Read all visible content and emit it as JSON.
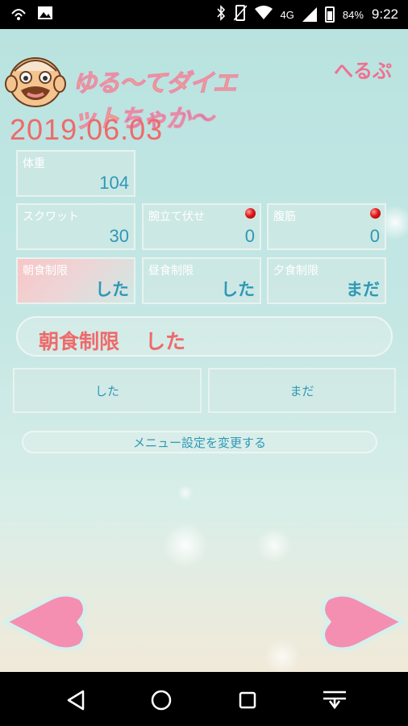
{
  "status_bar": {
    "battery_percent": "84%",
    "time": "9:22",
    "network": "4G"
  },
  "header": {
    "logo_text_main": "ゆる～てダイエット",
    "logo_text_accent": "ちゃか～",
    "help_label": "へるぷ"
  },
  "date": "2019.06.03",
  "stats": {
    "weight": {
      "label": "体重",
      "value": "104"
    },
    "squat": {
      "label": "スクワット",
      "value": "30"
    },
    "pushup": {
      "label": "腕立て伏せ",
      "value": "0"
    },
    "situp": {
      "label": "腹筋",
      "value": "0"
    }
  },
  "meals": {
    "breakfast": {
      "label": "朝食制限",
      "value": "した"
    },
    "lunch": {
      "label": "昼食制限",
      "value": "した"
    },
    "dinner": {
      "label": "夕食制限",
      "value": "まだ"
    }
  },
  "selection": {
    "item": "朝食制限",
    "status": "した"
  },
  "actions": {
    "done_label": "した",
    "notyet_label": "まだ",
    "menu_settings_label": "メニュー設定を変更する"
  },
  "colors": {
    "accent_red": "#ee6a6a",
    "value_blue": "#2f98b6",
    "help_pink": "#f16f8f",
    "heart_pink": "#f48fb1"
  }
}
